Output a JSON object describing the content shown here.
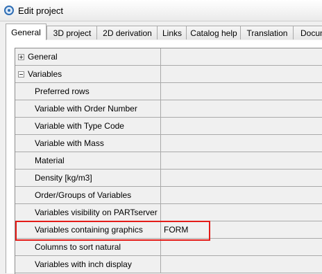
{
  "window": {
    "title": "Edit project"
  },
  "tabs": [
    {
      "label": "General",
      "active": true
    },
    {
      "label": "3D project"
    },
    {
      "label": "2D derivation"
    },
    {
      "label": "Links"
    },
    {
      "label": "Catalog help"
    },
    {
      "label": "Translation"
    },
    {
      "label": "Docum"
    }
  ],
  "properties": {
    "rows": [
      {
        "label": "General",
        "type": "group",
        "state": "collapsed",
        "value": ""
      },
      {
        "label": "Variables",
        "type": "group",
        "state": "expanded",
        "value": ""
      },
      {
        "label": "Preferred rows",
        "type": "item",
        "value": ""
      },
      {
        "label": "Variable with Order Number",
        "type": "item",
        "value": ""
      },
      {
        "label": "Variable with Type Code",
        "type": "item",
        "value": ""
      },
      {
        "label": "Variable with Mass",
        "type": "item",
        "value": ""
      },
      {
        "label": "Material",
        "type": "item",
        "value": ""
      },
      {
        "label": "Density [kg/m3]",
        "type": "item",
        "value": ""
      },
      {
        "label": "Order/Groups of Variables",
        "type": "item",
        "value": ""
      },
      {
        "label": "Variables visibility on PARTserver",
        "type": "item",
        "value": ""
      },
      {
        "label": "Variables containing graphics",
        "type": "item",
        "value": "FORM",
        "highlighted": true
      },
      {
        "label": "Columns to sort natural",
        "type": "item",
        "value": ""
      },
      {
        "label": "Variables with inch display",
        "type": "item",
        "value": ""
      }
    ]
  },
  "colors": {
    "highlight": "#e41b17",
    "grid_line": "#a9a9a9",
    "row_background": "#f0f0f0"
  }
}
